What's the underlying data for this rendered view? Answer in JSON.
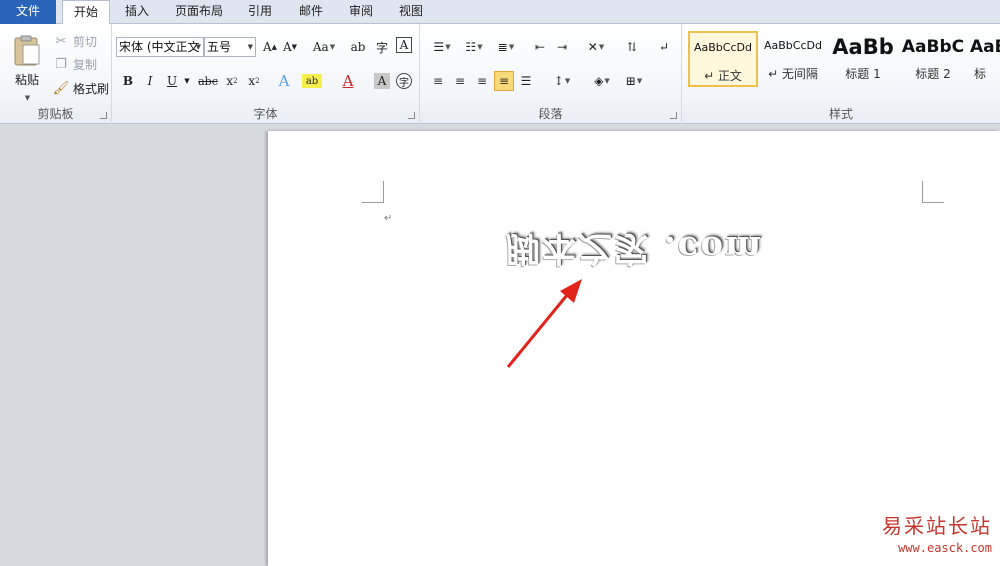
{
  "tabs": [
    {
      "label": "文件"
    },
    {
      "label": "开始"
    },
    {
      "label": "插入"
    },
    {
      "label": "页面布局"
    },
    {
      "label": "引用"
    },
    {
      "label": "邮件"
    },
    {
      "label": "审阅"
    },
    {
      "label": "视图"
    }
  ],
  "clipboard": {
    "group_label": "剪贴板",
    "paste_label": "粘贴",
    "cut_label": "剪切",
    "copy_label": "复制",
    "format_painter_label": "格式刷"
  },
  "font": {
    "group_label": "字体",
    "font_name": "宋体 (中文正文",
    "font_size": "五号"
  },
  "paragraph": {
    "group_label": "段落"
  },
  "styles": {
    "group_label": "样式",
    "items": [
      {
        "sample": "AaBbCcDd",
        "name": "↵ 正文"
      },
      {
        "sample": "AaBbCcDd",
        "name": "↵ 无间隔"
      },
      {
        "sample": "AaBb",
        "name": "标题 1"
      },
      {
        "sample": "AaBbC",
        "name": "标题 2"
      },
      {
        "sample": "AaB",
        "name": "标"
      }
    ]
  },
  "document": {
    "paragraph_mark": "↵",
    "mirrored_text": "脚本之家 .com"
  },
  "watermark": {
    "name": "易采站长站",
    "url": "www.easck.com"
  },
  "colors": {
    "file_tab": "#2a64b9",
    "arrow": "#e0241b",
    "watermark": "#c7362d",
    "selected_style": "#f0c04c"
  }
}
